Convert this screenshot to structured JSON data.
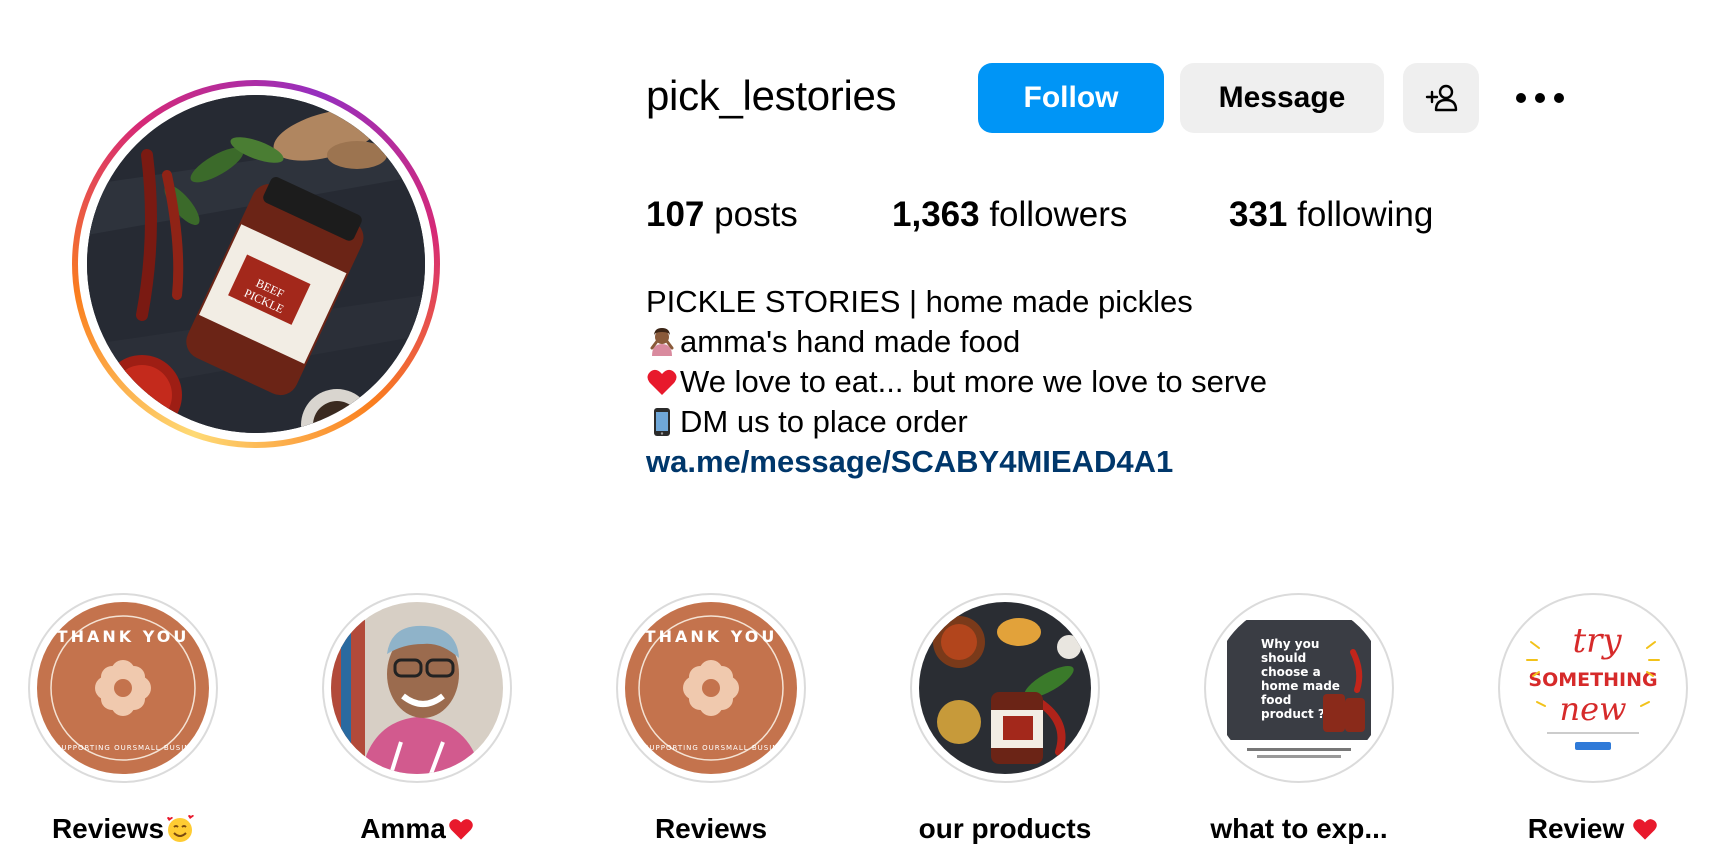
{
  "profile": {
    "username": "pick_lestories",
    "buttons": {
      "follow": "Follow",
      "message": "Message"
    },
    "stats": {
      "posts_count": "107",
      "posts_label": "posts",
      "followers_count": "1,363",
      "followers_label": "followers",
      "following_count": "331",
      "following_label": "following"
    },
    "bio": {
      "line1": "PICKLE STORIES | home made pickles",
      "line2": "amma's hand made food",
      "line3": "We love to eat... but more we love to serve",
      "line4": "DM us to place order",
      "link": "wa.me/message/SCABY4MIEAD4A1"
    }
  },
  "highlights": [
    {
      "label": "Reviews",
      "emoji": "smiling-face-with-hearts-icon",
      "cover_text": "THANK YOU FOR SUPPORTING OURSMALL BUSINESS!"
    },
    {
      "label": "Amma",
      "emoji": "red-heart-icon"
    },
    {
      "label": "Reviews",
      "cover_text": "THANK YOU FOR SUPPORTING OURSMALL BUSINESS!"
    },
    {
      "label": "our products"
    },
    {
      "label": "what to exp...",
      "cover_text": "Why you should choose a home made food product ?"
    },
    {
      "label": "Review",
      "emoji": "red-heart-icon",
      "cover_text": "try SOMETHING new"
    }
  ],
  "colors": {
    "follow_button": "#0095f6",
    "secondary_button": "#efefef",
    "link": "#00376b",
    "highlight_ring": "#dbdbdb",
    "thank_you_card": "#c4734d"
  }
}
